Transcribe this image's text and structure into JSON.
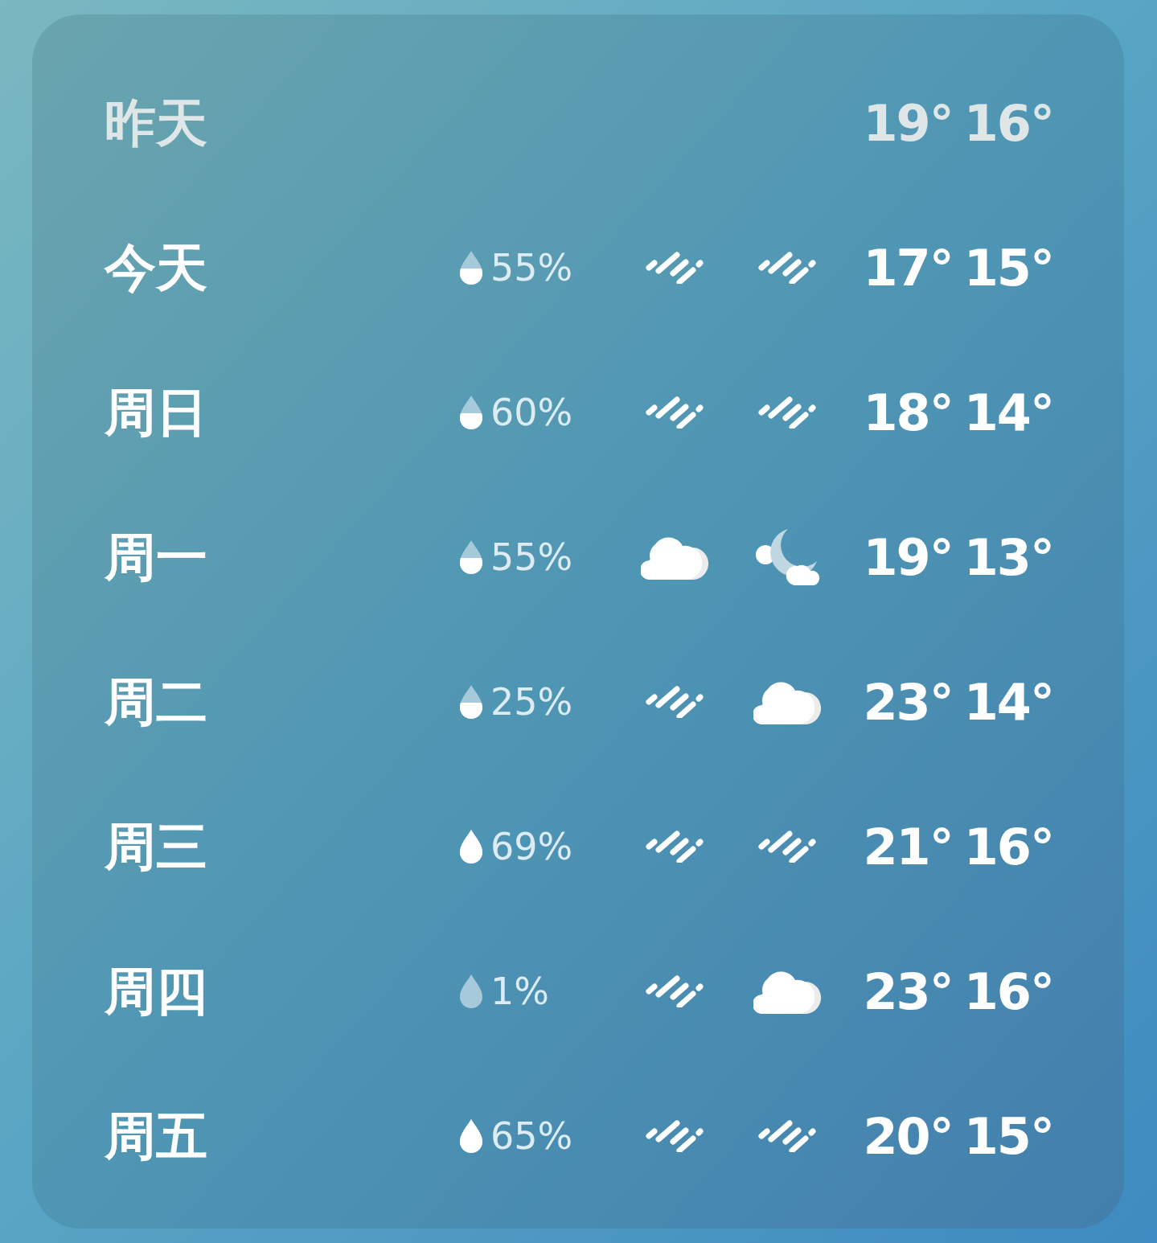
{
  "days": [
    {
      "label": "昨天",
      "dimmed": true,
      "high": "19°",
      "low": "16°"
    },
    {
      "label": "今天",
      "dimmed": false,
      "precip": {
        "text": "55%",
        "drop": {
          "kind": "half"
        }
      },
      "day": {
        "kind": "rain"
      },
      "night": {
        "kind": "rain"
      },
      "high": "17°",
      "low": "15°"
    },
    {
      "label": "周日",
      "dimmed": false,
      "precip": {
        "text": "60%",
        "drop": {
          "kind": "half"
        }
      },
      "day": {
        "kind": "rain"
      },
      "night": {
        "kind": "rain"
      },
      "high": "18°",
      "low": "14°"
    },
    {
      "label": "周一",
      "dimmed": false,
      "precip": {
        "text": "55%",
        "drop": {
          "kind": "half"
        }
      },
      "day": {
        "kind": "cloudy"
      },
      "night": {
        "kind": "night-cloudy"
      },
      "high": "19°",
      "low": "13°"
    },
    {
      "label": "周二",
      "dimmed": false,
      "precip": {
        "text": "25%",
        "drop": {
          "kind": "half"
        }
      },
      "day": {
        "kind": "rain"
      },
      "night": {
        "kind": "cloudy"
      },
      "high": "23°",
      "low": "14°"
    },
    {
      "label": "周三",
      "dimmed": false,
      "precip": {
        "text": "69%",
        "drop": {
          "kind": "full"
        }
      },
      "day": {
        "kind": "rain"
      },
      "night": {
        "kind": "rain"
      },
      "high": "21°",
      "low": "16°"
    },
    {
      "label": "周四",
      "dimmed": false,
      "precip": {
        "text": "1%",
        "drop": {
          "kind": "empty"
        }
      },
      "day": {
        "kind": "rain"
      },
      "night": {
        "kind": "cloudy"
      },
      "high": "23°",
      "low": "16°"
    },
    {
      "label": "周五",
      "dimmed": false,
      "precip": {
        "text": "65%",
        "drop": {
          "kind": "full"
        }
      },
      "day": {
        "kind": "rain"
      },
      "night": {
        "kind": "rain"
      },
      "high": "20°",
      "low": "15°"
    }
  ]
}
